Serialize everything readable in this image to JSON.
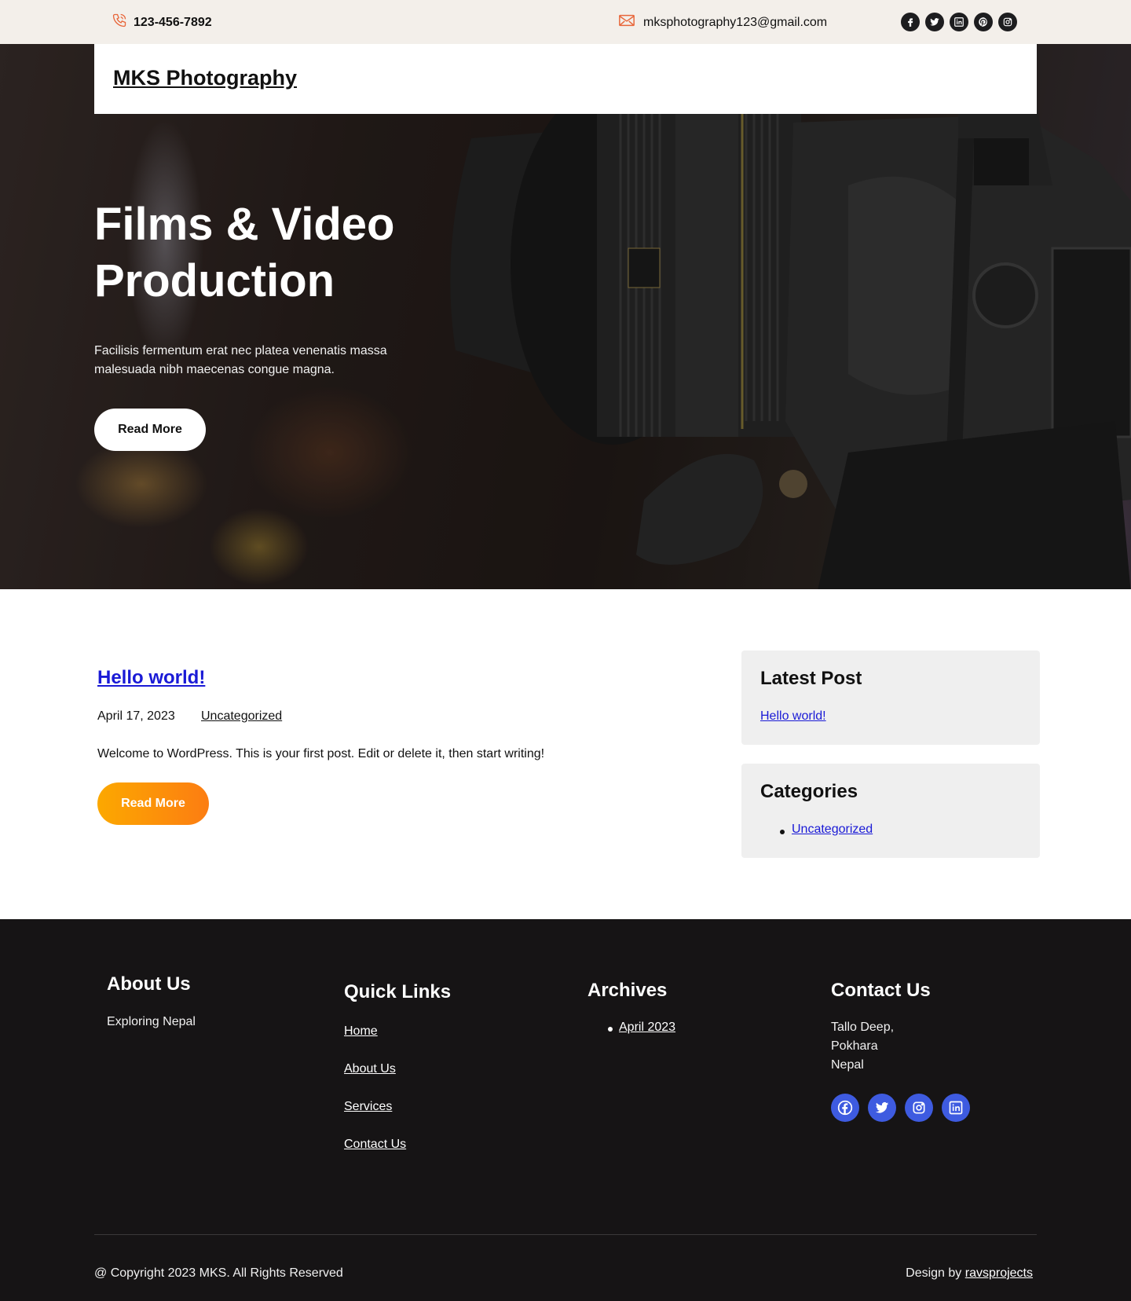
{
  "topbar": {
    "phone": "123-456-7892",
    "email": "mksphotography123@gmail.com",
    "social_icons": [
      "facebook-icon",
      "twitter-icon",
      "linkedin-icon",
      "pinterest-icon",
      "instagram-icon"
    ],
    "accent_color": "#e8663a"
  },
  "header": {
    "site_title": "MKS Photography"
  },
  "hero": {
    "title": "Films & Video Production",
    "subtitle": "Facilisis fermentum erat nec platea venenatis massa malesuada nibh maecenas congue magna.",
    "button_label": "Read More"
  },
  "post": {
    "title": "Hello world!",
    "date": "April 17, 2023",
    "category": "Uncategorized",
    "excerpt": "Welcome to WordPress. This is your first post. Edit or delete it, then start writing!",
    "button_label": "Read More",
    "title_color": "#1a1ad6",
    "button_gradient": [
      "#fca800",
      "#fc7d12"
    ]
  },
  "sidebar": {
    "latest_post": {
      "heading": "Latest Post",
      "items": [
        "Hello world!"
      ]
    },
    "categories": {
      "heading": "Categories",
      "items": [
        "Uncategorized"
      ]
    }
  },
  "footer": {
    "about": {
      "heading": "About Us",
      "text": "Exploring Nepal"
    },
    "quick_links": {
      "heading": "Quick Links",
      "items": [
        "Home",
        "About Us",
        "Services",
        "Contact Us"
      ]
    },
    "archives": {
      "heading": "Archives",
      "items": [
        "April 2023"
      ]
    },
    "contact": {
      "heading": "Contact Us",
      "address": [
        "Tallo Deep,",
        "Pokhara",
        "Nepal"
      ],
      "social_icons": [
        "facebook-icon",
        "twitter-icon",
        "instagram-icon",
        "linkedin-icon"
      ],
      "icon_color": "#3e5be0"
    },
    "copyright": "@ Copyright 2023 MKS. All Rights Reserved",
    "credit_prefix": "Design by",
    "credit_link": "ravsprojects",
    "background": "#161415"
  }
}
